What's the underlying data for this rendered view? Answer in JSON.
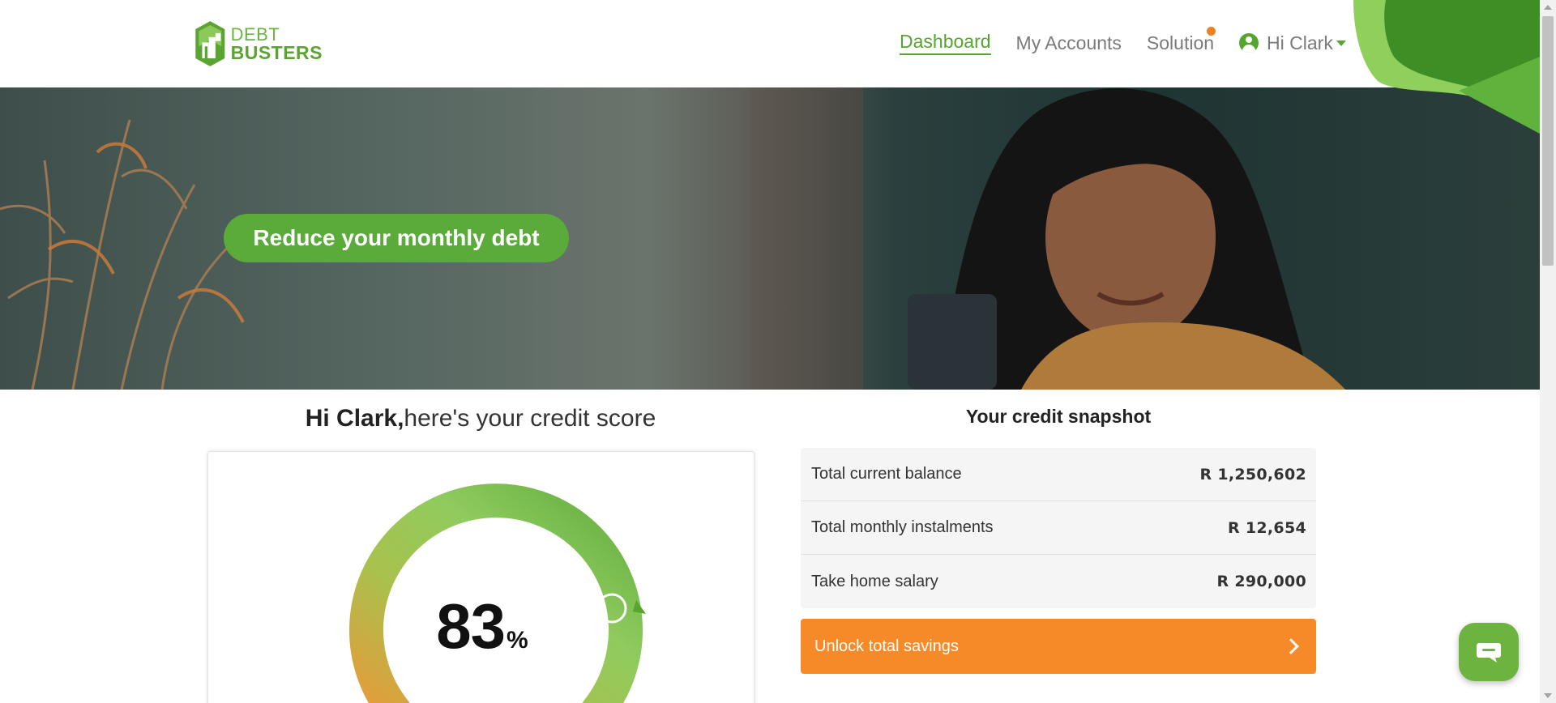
{
  "brand": {
    "logo_line1": "DEBT",
    "logo_line2": "BUSTERS",
    "primary_color": "#5aa532",
    "accent_color": "#f68a28"
  },
  "nav": {
    "items": [
      {
        "label": "Dashboard",
        "active": true
      },
      {
        "label": "My Accounts",
        "active": false
      },
      {
        "label": "Solution",
        "active": false,
        "notification": true
      }
    ],
    "user_label": "Hi Clark",
    "user_icon": "user-circle-icon",
    "dropdown_icon": "caret-down-icon"
  },
  "hero": {
    "cta_label": "Reduce your monthly debt"
  },
  "credit_score": {
    "greeting_name": "Hi Clark,",
    "greeting_rest": "here's your credit score",
    "value": "83",
    "unit": "%"
  },
  "snapshot": {
    "title": "Your credit snapshot",
    "rows": [
      {
        "label": "Total current balance",
        "value": "R 1,250,602"
      },
      {
        "label": "Total monthly instalments",
        "value": "R 12,654"
      },
      {
        "label": "Take home salary",
        "value": "R 290,000"
      }
    ],
    "unlock_label": "Unlock total savings",
    "unlock_icon": "chevron-right-icon"
  },
  "chat": {
    "icon": "chat-bubble-icon"
  }
}
